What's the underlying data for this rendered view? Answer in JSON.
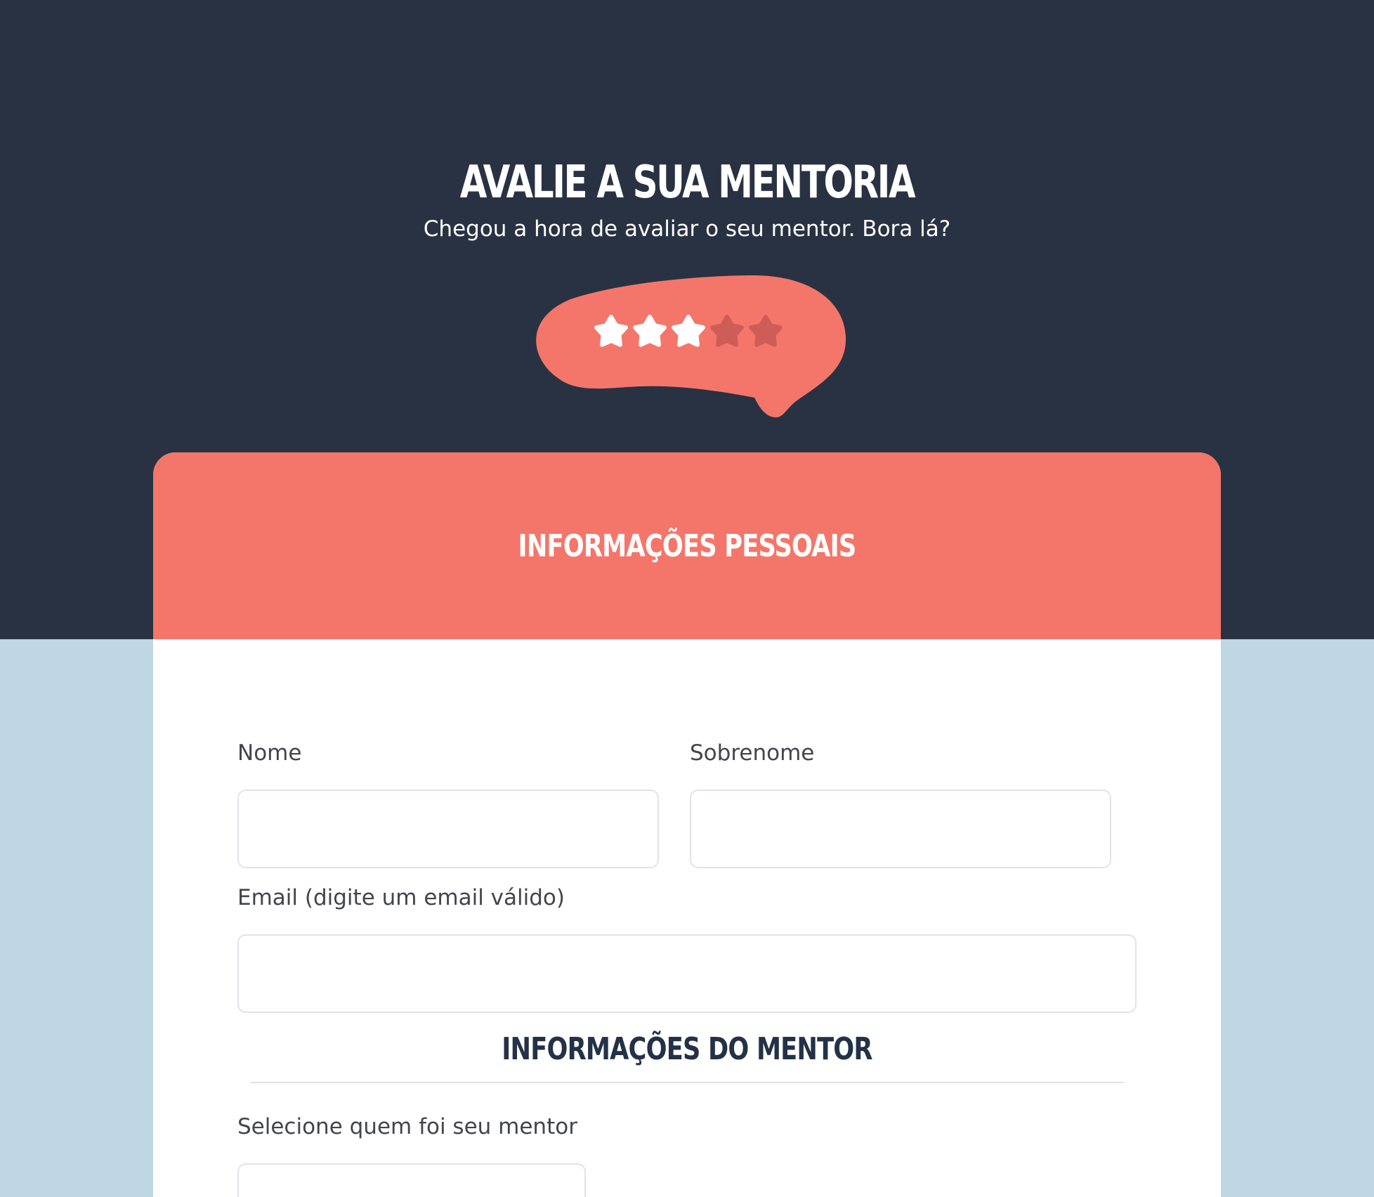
{
  "header": {
    "title": "AVALIE A SUA MENTORIA",
    "subtitle": "Chegou a hora de avaliar o seu mentor. Bora lá?"
  },
  "rating": {
    "filled": 3,
    "total": 5
  },
  "colors": {
    "dark": "#293242",
    "coral": "#f4766a",
    "light_blue": "#bfd7e4",
    "star_empty": "#cf5d57",
    "heading_dark": "#233246"
  },
  "personal": {
    "title": "INFORMAÇÕES PESSOAIS",
    "first_name_label": "Nome",
    "first_name_value": "",
    "last_name_label": "Sobrenome",
    "last_name_value": "",
    "email_label": "Email (digite um email válido)",
    "email_value": ""
  },
  "mentor": {
    "title": "INFORMAÇÕES DO MENTOR",
    "select_label": "Selecione quem foi seu mentor",
    "select_value": ""
  }
}
